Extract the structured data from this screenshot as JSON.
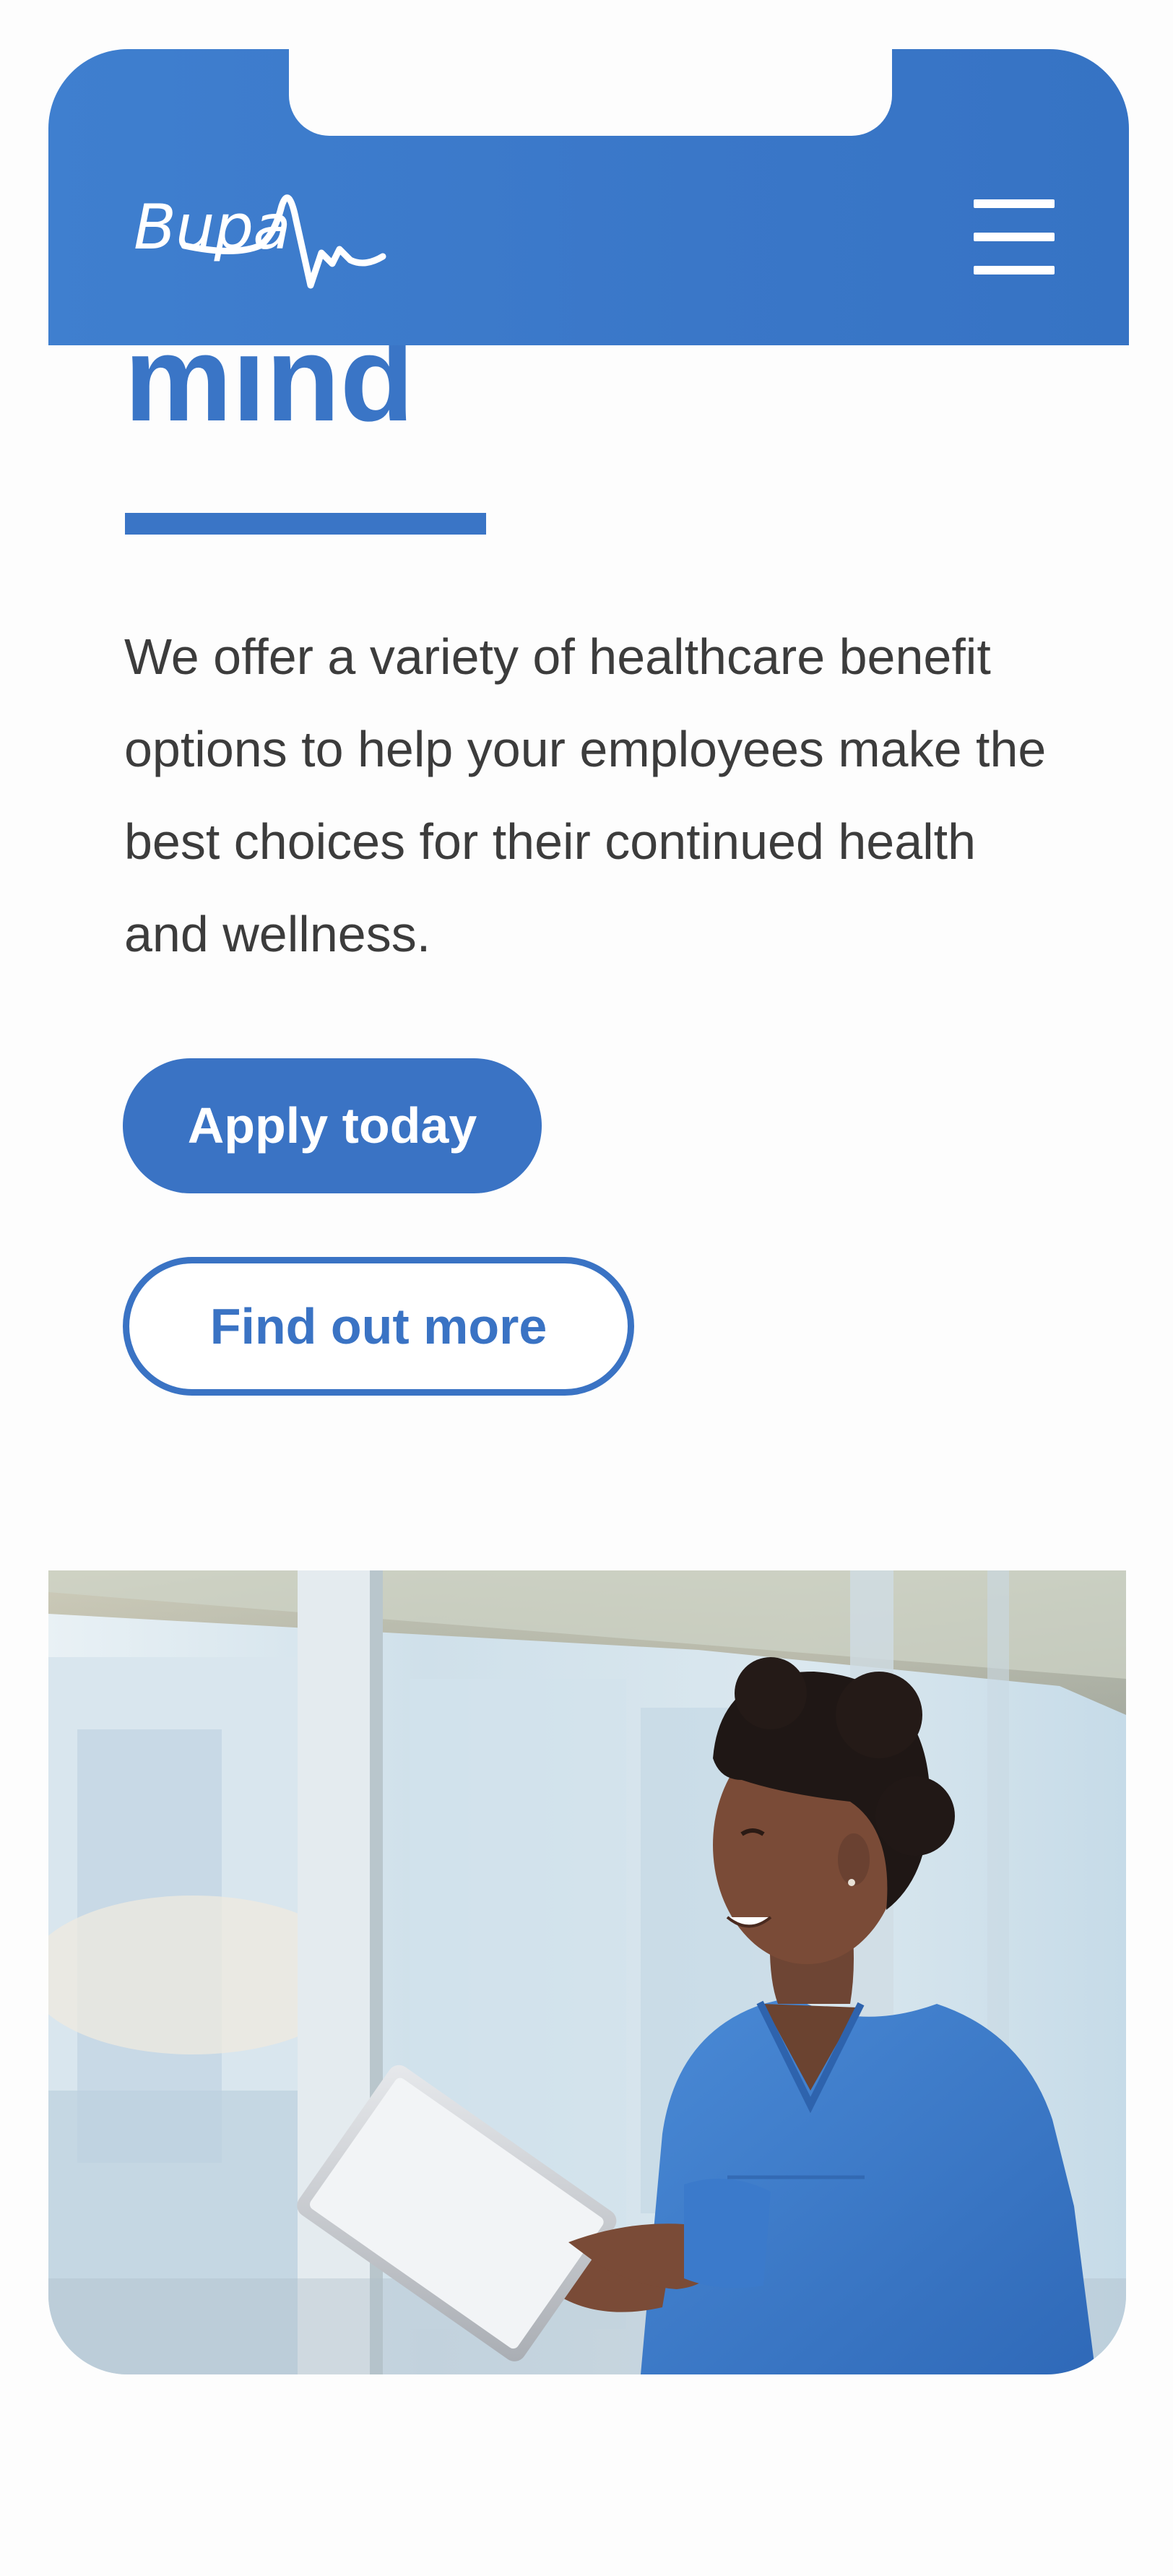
{
  "header": {
    "logo_text": "Bupa",
    "menu_icon": "hamburger-menu-icon",
    "background_color": "#3a78c9"
  },
  "hero": {
    "title_visible_fragment": "mind",
    "intro": "We offer a variety of healthcare benefit options to help your employees make the best choices for their continued health and wellness.",
    "accent_color": "#3a75c6",
    "text_color": "#3c3c3c"
  },
  "actions": {
    "primary_label": "Apply today",
    "secondary_label": "Find out more"
  },
  "image": {
    "subject": "smiling healthcare worker in blue scrubs holding a tablet"
  }
}
